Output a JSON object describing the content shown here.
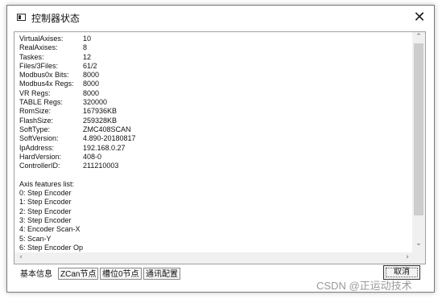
{
  "window": {
    "title": "控制器状态",
    "close_glyph": "✕"
  },
  "info": [
    {
      "key": "VirtualAxises:",
      "value": "10"
    },
    {
      "key": "RealAxises:",
      "value": "8"
    },
    {
      "key": "Taskes:",
      "value": "12"
    },
    {
      "key": "Files/3Files:",
      "value": "61/2"
    },
    {
      "key": "Modbus0x Bits:",
      "value": "8000"
    },
    {
      "key": "Modbus4x Regs:",
      "value": "8000"
    },
    {
      "key": "VR Regs:",
      "value": "8000"
    },
    {
      "key": "TABLE Regs:",
      "value": "320000"
    },
    {
      "key": "RomSize:",
      "value": "167936KB"
    },
    {
      "key": "FlashSize:",
      "value": "259328KB"
    },
    {
      "key": "SoftType:",
      "value": "ZMC408SCAN"
    },
    {
      "key": "SoftVersion:",
      "value": "4.890-20180817"
    },
    {
      "key": "IpAddress:",
      "value": "192.168.0.27"
    },
    {
      "key": "HardVersion:",
      "value": "408-0"
    },
    {
      "key": "ControllerID:",
      "value": "211210003"
    }
  ],
  "axis_header": "Axis features list:",
  "axes": [
    "0: Step Encoder",
    "1: Step Encoder",
    "2: Step Encoder",
    "3: Step Encoder",
    "4: Encoder Scan-X",
    "5: Scan-Y",
    "6: Step Encoder Op"
  ],
  "scroll": {
    "up": "⌃",
    "down": "⌄",
    "left": "‹",
    "right": "›"
  },
  "tabs": [
    "基本信息",
    "ZCan节点",
    "槽位0节点",
    "通讯配置"
  ],
  "cancel_label": "取消",
  "watermark": "CSDN @正运动技术"
}
